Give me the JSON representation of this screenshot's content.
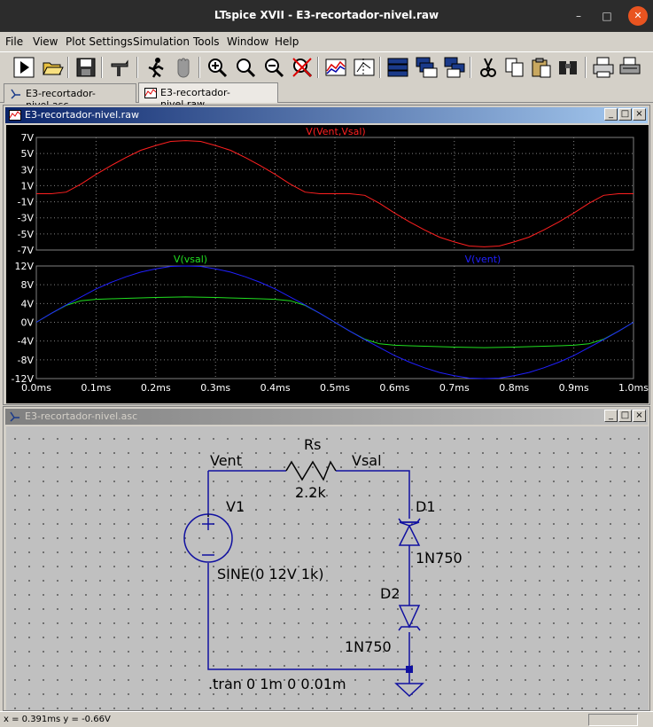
{
  "window": {
    "title": "LTspice XVII - E3-recortador-nivel.raw"
  },
  "menu": [
    "File",
    "View",
    "Plot Settings",
    "Simulation",
    "Tools",
    "Window",
    "Help"
  ],
  "toolbar_icons": [
    "run-icon",
    "open-icon",
    "save-icon",
    "control-panel-icon",
    "halt-icon",
    "pan-hand-icon",
    "zoom-in-icon",
    "zoom-full-icon",
    "zoom-out-icon",
    "zoom-cancel-icon",
    "autorange-icon",
    "mark-icon",
    "tile-horizontal-icon",
    "cascade-icon",
    "tile-vertical-icon",
    "cut-icon",
    "copy-icon",
    "paste-icon",
    "find-icon",
    "print-preview-icon",
    "print-icon"
  ],
  "tabs": [
    {
      "label": "E3-recortador-nivel.asc",
      "active": false
    },
    {
      "label": "E3-recortador-nivel.raw",
      "active": true
    }
  ],
  "plot_window": {
    "title": "E3-recortador-nivel.raw"
  },
  "schematic_window": {
    "title": "E3-recortador-nivel.asc",
    "labels": {
      "vent": "Vent",
      "vsal": "Vsal",
      "rs_name": "Rs",
      "rs_value": "2.2k",
      "v1_name": "V1",
      "v1_value": "SINE(0 12V 1k)",
      "d1_name": "D1",
      "d1_model": "1N750",
      "d2_name": "D2",
      "d2_model": "1N750",
      "directive": ".tran 0 1m 0 0.01m"
    }
  },
  "status": {
    "text": "x = 0.391ms    y = -0.66V"
  },
  "colors": {
    "red": "#ff2020",
    "green": "#20e020",
    "blue": "#2020ff",
    "wire": "#1010a0"
  },
  "chart_data": [
    {
      "type": "line",
      "series": [
        {
          "name": "V(Vent,Vsal)",
          "color": "#ff2020",
          "x": [
            0,
            0.025,
            0.05,
            0.075,
            0.1,
            0.125,
            0.15,
            0.175,
            0.2,
            0.225,
            0.25,
            0.275,
            0.3,
            0.325,
            0.35,
            0.375,
            0.4,
            0.425,
            0.45,
            0.475,
            0.5,
            0.525,
            0.55,
            0.575,
            0.6,
            0.625,
            0.65,
            0.675,
            0.7,
            0.725,
            0.75,
            0.775,
            0.8,
            0.825,
            0.85,
            0.875,
            0.9,
            0.925,
            0.95,
            0.975,
            1.0
          ],
          "y": [
            0,
            0,
            0.2,
            1.2,
            2.4,
            3.5,
            4.5,
            5.4,
            6.0,
            6.5,
            6.6,
            6.5,
            6.0,
            5.4,
            4.5,
            3.5,
            2.4,
            1.2,
            0.2,
            0,
            0,
            0,
            -0.2,
            -1.2,
            -2.4,
            -3.5,
            -4.5,
            -5.4,
            -6.0,
            -6.5,
            -6.6,
            -6.5,
            -6.0,
            -5.4,
            -4.5,
            -3.5,
            -2.4,
            -1.2,
            -0.2,
            0,
            0
          ]
        }
      ],
      "ylim": [
        -7,
        7
      ],
      "yticks": [
        "7V",
        "5V",
        "3V",
        "1V",
        "-1V",
        "-3V",
        "-5V",
        "-7V"
      ]
    },
    {
      "type": "line",
      "series": [
        {
          "name": "V(vsal)",
          "color": "#20e020",
          "x": [
            0,
            0.025,
            0.05,
            0.075,
            0.1,
            0.125,
            0.15,
            0.2,
            0.25,
            0.3,
            0.35,
            0.375,
            0.4,
            0.425,
            0.45,
            0.475,
            0.5,
            0.525,
            0.55,
            0.575,
            0.6,
            0.625,
            0.65,
            0.7,
            0.75,
            0.8,
            0.85,
            0.875,
            0.9,
            0.925,
            0.95,
            0.975,
            1.0
          ],
          "y": [
            0,
            1.9,
            3.6,
            4.6,
            4.9,
            5.0,
            5.1,
            5.3,
            5.4,
            5.3,
            5.1,
            5.0,
            4.9,
            4.6,
            3.6,
            1.9,
            0,
            -1.9,
            -3.6,
            -4.6,
            -4.9,
            -5.0,
            -5.1,
            -5.3,
            -5.4,
            -5.3,
            -5.1,
            -5.0,
            -4.9,
            -4.6,
            -3.6,
            -1.9,
            0
          ]
        },
        {
          "name": "V(vent)",
          "color": "#2020ff",
          "x": [
            0,
            0.025,
            0.05,
            0.075,
            0.1,
            0.125,
            0.15,
            0.175,
            0.2,
            0.225,
            0.25,
            0.275,
            0.3,
            0.325,
            0.35,
            0.375,
            0.4,
            0.425,
            0.45,
            0.475,
            0.5,
            0.525,
            0.55,
            0.575,
            0.6,
            0.625,
            0.65,
            0.675,
            0.7,
            0.725,
            0.75,
            0.775,
            0.8,
            0.825,
            0.85,
            0.875,
            0.9,
            0.925,
            0.95,
            0.975,
            1.0
          ],
          "y": [
            0,
            1.9,
            3.7,
            5.4,
            7.1,
            8.5,
            9.7,
            10.7,
            11.4,
            11.9,
            12.0,
            11.9,
            11.4,
            10.7,
            9.7,
            8.5,
            7.1,
            5.4,
            3.7,
            1.9,
            0,
            -1.9,
            -3.7,
            -5.4,
            -7.1,
            -8.5,
            -9.7,
            -10.7,
            -11.4,
            -11.9,
            -12.0,
            -11.9,
            -11.4,
            -10.7,
            -9.7,
            -8.5,
            -7.1,
            -5.4,
            -3.7,
            -1.9,
            0
          ]
        }
      ],
      "ylim": [
        -12,
        12
      ],
      "yticks": [
        "12V",
        "8V",
        "4V",
        "0V",
        "-4V",
        "-8V",
        "-12V"
      ],
      "xlim": [
        0,
        1.0
      ],
      "xticks": [
        "0.0ms",
        "0.1ms",
        "0.2ms",
        "0.3ms",
        "0.4ms",
        "0.5ms",
        "0.6ms",
        "0.7ms",
        "0.8ms",
        "0.9ms",
        "1.0ms"
      ]
    }
  ]
}
